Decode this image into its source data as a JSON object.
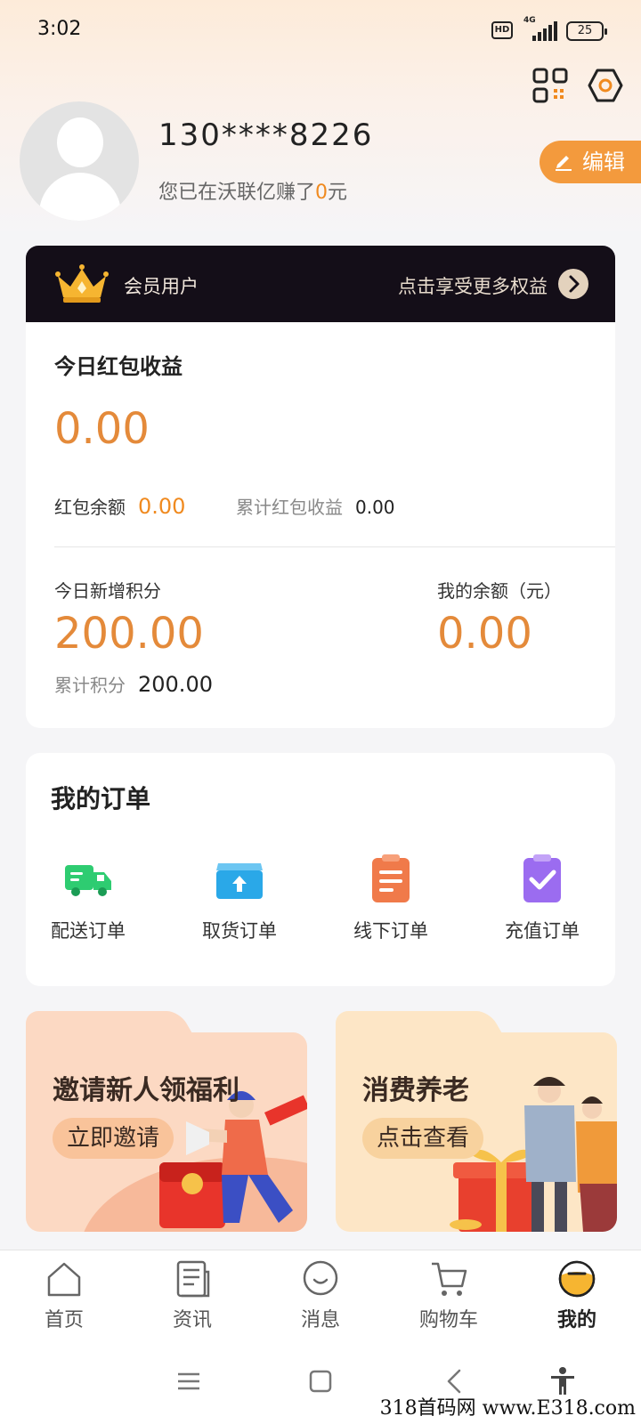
{
  "status_bar": {
    "time": "3:02",
    "hd": "HD",
    "network": "4G",
    "battery": "25"
  },
  "profile": {
    "phone": "130****8226",
    "earned_prefix": "您已在沃联亿赚了",
    "earned_amount": "0",
    "earned_suffix": "元",
    "edit_label": "编辑"
  },
  "member": {
    "label": "会员用户",
    "link": "点击享受更多权益"
  },
  "earnings": {
    "title": "今日红包收益",
    "today_value": "0.00",
    "balance_label": "红包余额",
    "balance_value": "0.00",
    "cumulative_label": "累计红包收益",
    "cumulative_value": "0.00",
    "points_label": "今日新增积分",
    "points_value": "200.00",
    "my_balance_label": "我的余额（元）",
    "my_balance_value": "0.00",
    "total_points_label": "累计积分",
    "total_points_value": "200.00"
  },
  "orders": {
    "title": "我的订单",
    "items": [
      {
        "label": "配送订单",
        "icon": "delivery-truck-icon",
        "color": "#2ecc71"
      },
      {
        "label": "取货订单",
        "icon": "pickup-box-icon",
        "color": "#2aa8e8"
      },
      {
        "label": "线下订单",
        "icon": "offline-clipboard-icon",
        "color": "#f07a4a"
      },
      {
        "label": "充值订单",
        "icon": "recharge-check-icon",
        "color": "#9b6cf0"
      }
    ]
  },
  "promos": [
    {
      "title": "邀请新人领福利",
      "button": "立即邀请"
    },
    {
      "title": "消费养老",
      "button": "点击查看"
    }
  ],
  "tabs": [
    {
      "label": "首页",
      "icon": "home-icon"
    },
    {
      "label": "资讯",
      "icon": "news-icon"
    },
    {
      "label": "消息",
      "icon": "message-icon"
    },
    {
      "label": "购物车",
      "icon": "cart-icon"
    },
    {
      "label": "我的",
      "icon": "profile-face-icon",
      "active": true
    }
  ],
  "watermark": "318首码网 www.E318.com",
  "colors": {
    "accent": "#f08a1f",
    "value_orange": "#e48a3a",
    "member_bar": "#140e18"
  }
}
